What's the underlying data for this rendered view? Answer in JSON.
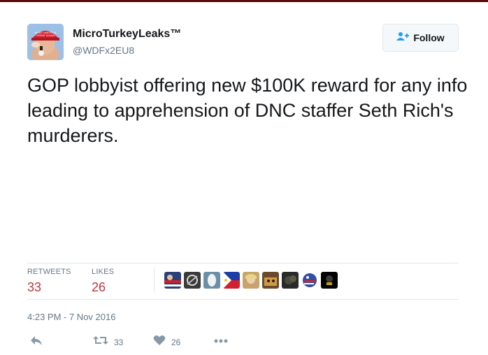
{
  "user": {
    "display_name": "MicroTurkeyLeaks™",
    "handle": "@WDFx2EU8"
  },
  "follow_button": {
    "label": "Follow",
    "icon": "follow-user-icon"
  },
  "tweet": {
    "text": "GOP lobbyist offering new $100K reward for any info leading to apprehension of DNC staffer Seth Rich's murderers."
  },
  "stats": {
    "retweets_label": "RETWEETS",
    "retweets_count": "33",
    "likes_label": "LIKES",
    "likes_count": "26"
  },
  "timestamp": "4:23 PM - 7 Nov 2016",
  "actions": {
    "reply_icon": "reply-icon",
    "retweet_icon": "retweet-icon",
    "retweet_count": "33",
    "like_icon": "heart-icon",
    "like_count": "26",
    "more_icon": "more-icon"
  },
  "colors": {
    "accent": "#c2343c",
    "secondary_text": "#657786",
    "border": "#e1e8ed"
  }
}
